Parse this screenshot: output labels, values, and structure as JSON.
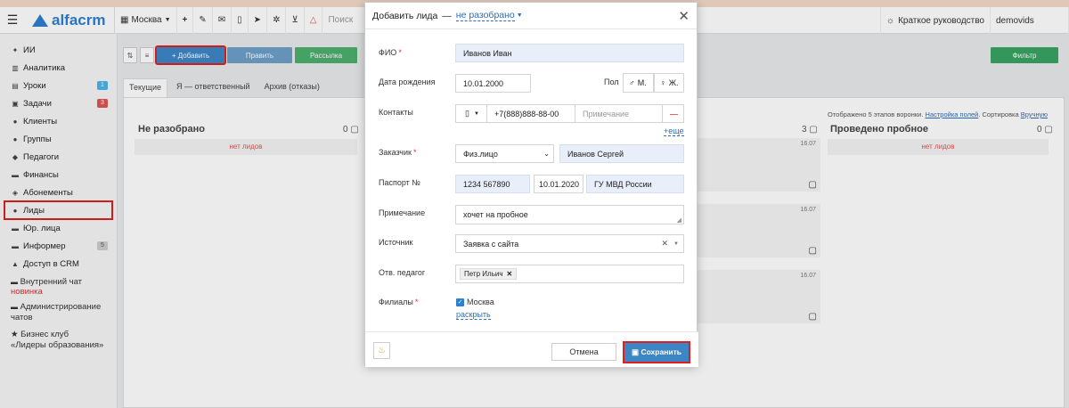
{
  "topbar": {
    "logo_text": "alfacrm",
    "branch": "Москва",
    "search_label": "Поиск",
    "guide_label": "Краткое руководство",
    "user": "demovids"
  },
  "sidebar": {
    "items": [
      {
        "label": "ИИ",
        "icon": "wand-icon"
      },
      {
        "label": "Аналитика",
        "icon": "chart-icon"
      },
      {
        "label": "Уроки",
        "icon": "calendar-icon",
        "badge": "1",
        "badge_color": "#4ab6e8"
      },
      {
        "label": "Задачи",
        "icon": "tasks-icon",
        "badge": "3",
        "badge_color": "#e05555"
      },
      {
        "label": "Клиенты",
        "icon": "user-icon"
      },
      {
        "label": "Группы",
        "icon": "users-icon"
      },
      {
        "label": "Педагоги",
        "icon": "teacher-icon"
      },
      {
        "label": "Финансы",
        "icon": "money-icon"
      },
      {
        "label": "Абонементы",
        "icon": "tag-icon"
      },
      {
        "label": "Лиды",
        "icon": "lead-icon"
      },
      {
        "label": "Юр. лица",
        "icon": "building-icon"
      },
      {
        "label": "Информер",
        "icon": "inbox-icon",
        "badge": "5",
        "badge_color": "#cccccc"
      },
      {
        "label": "Доступ в CRM",
        "icon": "lock-icon"
      }
    ],
    "chat_label": "Внутренний чат",
    "chat_new": "новинка",
    "admin_label_1": "Администрирование",
    "admin_label_2": "чатов",
    "club_label_1": "Бизнес клуб",
    "club_label_2": "«Лидеры образования»"
  },
  "main": {
    "buttons": {
      "add": "+ Добавить",
      "edit": "Править",
      "mailing": "Рассылка",
      "filter": "Фильтр"
    },
    "tabs": [
      "Текущие",
      "Я — ответственный",
      "Архив (отказы)"
    ],
    "col1": {
      "title": "Не разобрано",
      "count": "0",
      "empty": "нет лидов"
    },
    "col_mid_count": "3",
    "col4": {
      "title": "Проведено пробное",
      "count": "0",
      "empty": "нет лидов"
    },
    "hidden_note": "Отображено 5 этапов воронки.",
    "settings_link": "Настройка полей",
    "sort_label": "Сортировка",
    "sort_value": "Вручную",
    "dates": [
      "16.07",
      "16.07",
      "16.07"
    ]
  },
  "modal": {
    "title": "Добавить лида",
    "dash": "—",
    "status": "не разобрано",
    "fio_label": "ФИО",
    "fio_value": "Иванов Иван",
    "dob_label": "Дата рождения",
    "dob_value": "10.01.2000",
    "gender_label": "Пол",
    "gender_m": "М.",
    "gender_f": "Ж.",
    "contacts_label": "Контакты",
    "phone": "+7(888)888-88-00",
    "phone_note_placeholder": "Примечание",
    "more_link": "+еще",
    "customer_label": "Заказчик",
    "customer_type": "Физ.лицо",
    "customer_name": "Иванов Сергей",
    "passport_label": "Паспорт №",
    "passport_number": "1234 567890",
    "passport_date": "10.01.2020",
    "passport_issuer": "ГУ МВД России",
    "note_label": "Примечание",
    "note_value": "хочет на пробное",
    "source_label": "Источник",
    "source_value": "Заявка с сайта",
    "teacher_label": "Отв. педагог",
    "teacher_value": "Петр Ильич",
    "branches_label": "Филиалы",
    "branch_value": "Москва",
    "expand_link": "раскрыть",
    "cancel": "Отмена",
    "save": "Сохранить"
  }
}
